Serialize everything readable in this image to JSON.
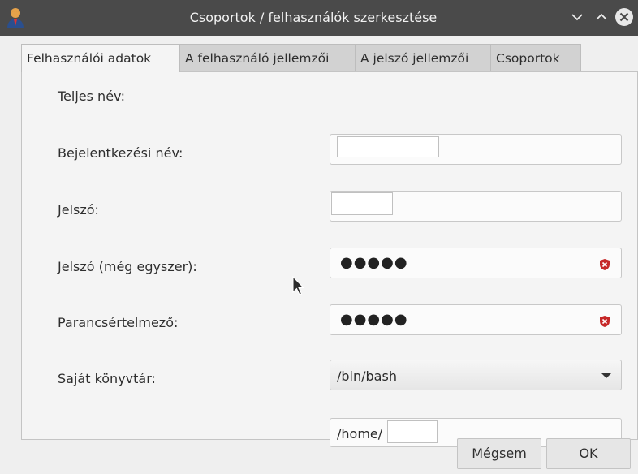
{
  "window": {
    "title": "Csoportok / felhasználók szerkesztése",
    "icon": "user-admin-icon",
    "controls": [
      "minimize-icon",
      "maximize-icon",
      "close-icon"
    ]
  },
  "tabs": [
    {
      "label": "Felhasználói adatok",
      "active": true
    },
    {
      "label": "A felhasználó jellemzői",
      "active": false
    },
    {
      "label": "A jelszó jellemzői",
      "active": false
    },
    {
      "label": "Csoportok",
      "active": false
    }
  ],
  "form": {
    "full_name": {
      "label": "Teljes név:",
      "value": ""
    },
    "login": {
      "label": "Bejelentkezési név:",
      "value": ""
    },
    "password": {
      "label": "Jelszó:",
      "value": "●●●●●"
    },
    "password_again": {
      "label": "Jelszó (még egyszer):",
      "value": "●●●●●"
    },
    "shell": {
      "label": "Parancsértelmező:",
      "value": "/bin/bash"
    },
    "home": {
      "label": "Saját könyvtár:",
      "value": "/home/"
    }
  },
  "buttons": {
    "cancel": "Mégsem",
    "ok": "OK"
  },
  "colors": {
    "titlebar": "#4a4a4a",
    "background": "#efefef",
    "warning": "#c62828"
  }
}
